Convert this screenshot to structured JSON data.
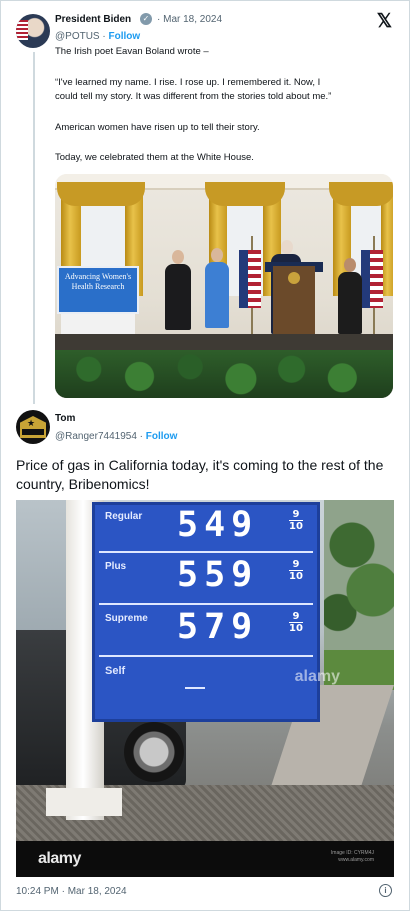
{
  "quoted_tweet": {
    "author_name": "President Biden",
    "date": "· Mar 18, 2024",
    "handle": "@POTUS",
    "separator": " · ",
    "follow_label": "Follow",
    "lines": [
      "The Irish poet Eavan Boland wrote –",
      "“I've learned my name. I rise. I rose up. I remembered it. Now, I",
      "could tell my story. It was different from the stories told about me.”",
      "American women have risen up to tell their story.",
      "Today, we celebrated them at the White House."
    ],
    "photo": {
      "sign_text": "Advancing Women's Health Research",
      "icon": "event-photo"
    }
  },
  "tweet": {
    "author_name": "Tom",
    "handle": "@Ranger7441954",
    "separator": " · ",
    "follow_label": "Follow",
    "text": "Price of gas in California today, it's coming to the rest of the country, Bribenomics!",
    "timestamp": "10:24 PM · Mar 18, 2024"
  },
  "gas_sign": {
    "rows": [
      {
        "grade": "Regular",
        "price": "549",
        "tenth_top": "9",
        "tenth_bottom": "10"
      },
      {
        "grade": "Plus",
        "price": "559",
        "tenth_top": "9",
        "tenth_bottom": "10"
      },
      {
        "grade": "Supreme",
        "price": "579",
        "tenth_top": "9",
        "tenth_bottom": "10"
      }
    ],
    "self_label": "Self",
    "board_color": "#2b55c4"
  },
  "watermark": {
    "logo": "alamy",
    "overlay": "alamy",
    "image_id": "Image ID: CYRM4J",
    "site": "www.alamy.com"
  },
  "colors": {
    "link": "#1d9bf0",
    "muted": "#536471",
    "border": "#cfd9de"
  },
  "icons": {
    "x_logo": "𝕏",
    "verified": "✓",
    "info": "i"
  }
}
